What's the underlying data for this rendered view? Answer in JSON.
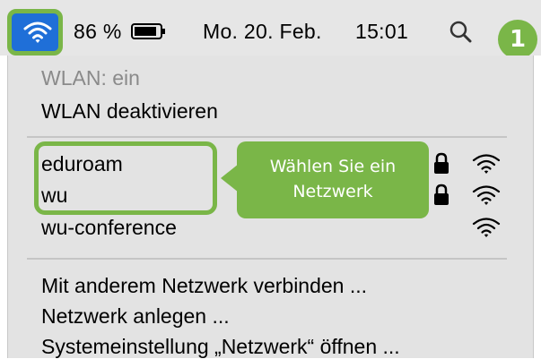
{
  "menubar": {
    "battery_percent": "86 %",
    "date": "Mo. 20. Feb.",
    "time": "15:01"
  },
  "step_badge": "1",
  "menu": {
    "wlan_status": "WLAN: ein",
    "wlan_toggle": "WLAN deaktivieren",
    "networks": [
      {
        "name": "eduroam",
        "locked": true
      },
      {
        "name": "wu",
        "locked": true
      },
      {
        "name": "wu-conference",
        "locked": false
      }
    ],
    "actions": [
      "Mit anderem Netzwerk verbinden ...",
      "Netzwerk anlegen ...",
      "Systemeinstellung „Netzwerk“ öffnen ..."
    ]
  },
  "callout": {
    "line1": "Wählen Sie ein",
    "line2": "Netzwerk"
  },
  "colors": {
    "accent_green": "#7ab648",
    "wifi_tile_blue": "#1f6fd8",
    "menu_bg": "#e3e3e3"
  },
  "icons": [
    "wifi-icon",
    "battery-icon",
    "search-icon",
    "lock-icon",
    "wifi-signal-icon"
  ]
}
